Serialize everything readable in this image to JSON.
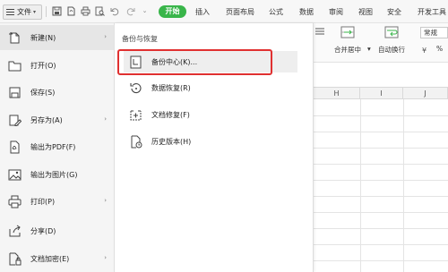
{
  "topbar": {
    "file_label": "文件",
    "start_label": "开始",
    "tabs": [
      "插入",
      "页面布局",
      "公式",
      "数据",
      "审阅",
      "视图",
      "安全",
      "开发工具"
    ]
  },
  "ribbon": {
    "merge_label": "合并居中",
    "wrap_label": "自动换行",
    "format_value": "常规",
    "percent_label": "%"
  },
  "sheet": {
    "columns": [
      "H",
      "I",
      "J"
    ]
  },
  "file_menu": {
    "items": [
      {
        "label": "新建(N)",
        "icon": "new-file-icon",
        "has_submenu": true
      },
      {
        "label": "打开(O)",
        "icon": "folder-open-icon",
        "has_submenu": false
      },
      {
        "label": "保存(S)",
        "icon": "save-icon",
        "has_submenu": false
      },
      {
        "label": "另存为(A)",
        "icon": "save-as-icon",
        "has_submenu": true
      },
      {
        "label": "输出为PDF(F)",
        "icon": "pdf-export-icon",
        "has_submenu": false
      },
      {
        "label": "输出为图片(G)",
        "icon": "image-export-icon",
        "has_submenu": false
      },
      {
        "label": "打印(P)",
        "icon": "print-icon",
        "has_submenu": true
      },
      {
        "label": "分享(D)",
        "icon": "share-icon",
        "has_submenu": false
      },
      {
        "label": "文档加密(E)",
        "icon": "encrypt-icon",
        "has_submenu": true
      }
    ]
  },
  "sub_menu": {
    "title": "备份与恢复",
    "items": [
      {
        "label": "备份中心(K)...",
        "icon": "backup-center-icon"
      },
      {
        "label": "数据恢复(R)",
        "icon": "data-recovery-icon"
      },
      {
        "label": "文档修复(F)",
        "icon": "document-repair-icon"
      },
      {
        "label": "历史版本(H)",
        "icon": "history-version-icon"
      }
    ]
  },
  "colors": {
    "start_pill": "#39b54a",
    "highlight_border": "#e03030",
    "menu_bg": "#f5f5f5"
  }
}
